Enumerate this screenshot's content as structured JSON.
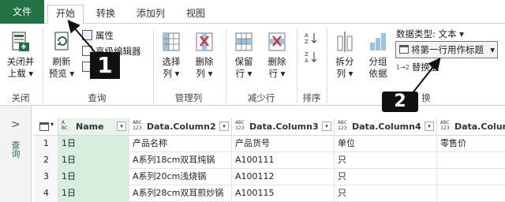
{
  "tabs": [
    "文件",
    "开始",
    "转换",
    "添加列",
    "视图"
  ],
  "ribbon": {
    "close_upload": [
      "关闭并",
      "上载 ▾"
    ],
    "refresh": [
      "刷新",
      "预览 ▾"
    ],
    "properties": "属性",
    "advanced_editor": "高级编辑器",
    "choose_cols": [
      "选择",
      "列 ▾"
    ],
    "remove_cols": [
      "删除",
      "列 ▾"
    ],
    "keep_rows": [
      "保留",
      "行 ▾"
    ],
    "remove_rows": [
      "删除",
      "行 ▾"
    ],
    "split_col": [
      "拆分",
      "列 ▾"
    ],
    "group_by": [
      "分组",
      "依据"
    ],
    "data_type": "数据类型: 文本 ▾",
    "use_first_row": "将第一行用作标题",
    "replace": "替换值",
    "groups": {
      "close": "关闭",
      "query": "查询",
      "manage_cols": "管理列",
      "reduce_rows": "减少行",
      "sort": "排序",
      "transform": "换"
    }
  },
  "markers": [
    "1",
    "2"
  ],
  "leftpane": {
    "chevron": ">",
    "label": "查询"
  },
  "grid": {
    "headers": [
      {
        "type": "A\nBC",
        "name": "Name"
      },
      {
        "type": "ABC\n123",
        "name": "Data.Column2"
      },
      {
        "type": "ABC\n123",
        "name": "Data.Column3"
      },
      {
        "type": "ABC\n123",
        "name": "Data.Column4"
      },
      {
        "type": "ABC\n123",
        "name": "Data.Colum"
      }
    ],
    "rows": [
      {
        "num": "1",
        "cells": [
          "1日",
          "产品名称",
          "产品货号",
          "单位",
          "零售价"
        ]
      },
      {
        "num": "2",
        "cells": [
          "1日",
          "A系列18cm双耳炖锅",
          "A100111",
          "只",
          ""
        ]
      },
      {
        "num": "3",
        "cells": [
          "1日",
          "A系列20cm浅烧锅",
          "A100112",
          "只",
          ""
        ]
      },
      {
        "num": "4",
        "cells": [
          "1日",
          "A系列28cm双耳煎炒锅",
          "A100115",
          "只",
          ""
        ]
      }
    ]
  },
  "colors": {
    "file_tab": "#217346",
    "selected_col": "#d7eedf",
    "selected_hdr": "#e6f2ea"
  }
}
